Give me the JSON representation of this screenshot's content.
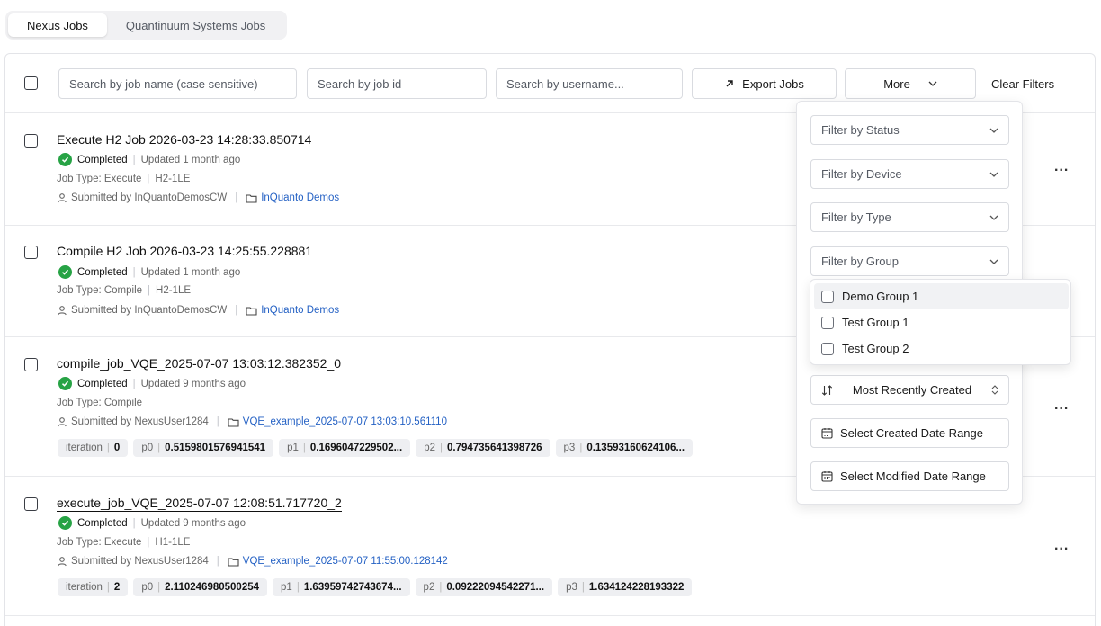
{
  "tabs": [
    {
      "label": "Nexus Jobs",
      "active": true
    },
    {
      "label": "Quantinuum Systems Jobs",
      "active": false
    }
  ],
  "toolbar": {
    "search_name_placeholder": "Search by job name (case sensitive)",
    "search_id_placeholder": "Search by job id",
    "search_user_placeholder": "Search by username...",
    "export_label": "Export Jobs",
    "more_label": "More",
    "clear_label": "Clear Filters"
  },
  "jobs": [
    {
      "title": "Execute H2 Job 2026-03-23 14:28:33.850714",
      "status": "Completed",
      "updated": "Updated 1 month ago",
      "job_type": "Job Type: Execute",
      "device": "H2-1LE",
      "submitted": "Submitted by InQuantoDemosCW",
      "project": "InQuanto Demos"
    },
    {
      "title": "Compile H2 Job 2026-03-23 14:25:55.228881",
      "status": "Completed",
      "updated": "Updated 1 month ago",
      "job_type": "Job Type: Compile",
      "device": "H2-1LE",
      "submitted": "Submitted by InQuantoDemosCW",
      "project": "InQuanto Demos"
    },
    {
      "title": "compile_job_VQE_2025-07-07 13:03:12.382352_0",
      "status": "Completed",
      "updated": "Updated 9 months ago",
      "job_type": "Job Type: Compile",
      "submitted": "Submitted by NexusUser1284",
      "project": "VQE_example_2025-07-07 13:03:10.561110",
      "chips": [
        {
          "k": "iteration",
          "v": "0"
        },
        {
          "k": "p0",
          "v": "0.5159801576941541"
        },
        {
          "k": "p1",
          "v": "0.1696047229502..."
        },
        {
          "k": "p2",
          "v": "0.794735641398726"
        },
        {
          "k": "p3",
          "v": "0.13593160624106..."
        }
      ]
    },
    {
      "title": "execute_job_VQE_2025-07-07 12:08:51.717720_2",
      "status": "Completed",
      "updated": "Updated 9 months ago",
      "job_type": "Job Type: Execute",
      "device": "H1-1LE",
      "submitted": "Submitted by NexusUser1284",
      "project": "VQE_example_2025-07-07 11:55:00.128142",
      "chips": [
        {
          "k": "iteration",
          "v": "2"
        },
        {
          "k": "p0",
          "v": "2.110246980500254"
        },
        {
          "k": "p1",
          "v": "1.63959742743674..."
        },
        {
          "k": "p2",
          "v": "0.09222094542271..."
        },
        {
          "k": "p3",
          "v": "1.634124228193322"
        }
      ]
    }
  ],
  "row_menu": "...",
  "filters": {
    "status": "Filter by Status",
    "device": "Filter by Device",
    "type": "Filter by Type",
    "group": "Filter by Group",
    "groups": [
      "Demo Group 1",
      "Test Group 1",
      "Test Group 2"
    ],
    "sort": "Most Recently Created",
    "created_range": "Select Created Date Range",
    "modified_range": "Select Modified Date Range"
  },
  "colors": {
    "success": "#27a345",
    "link": "#2461c4"
  }
}
